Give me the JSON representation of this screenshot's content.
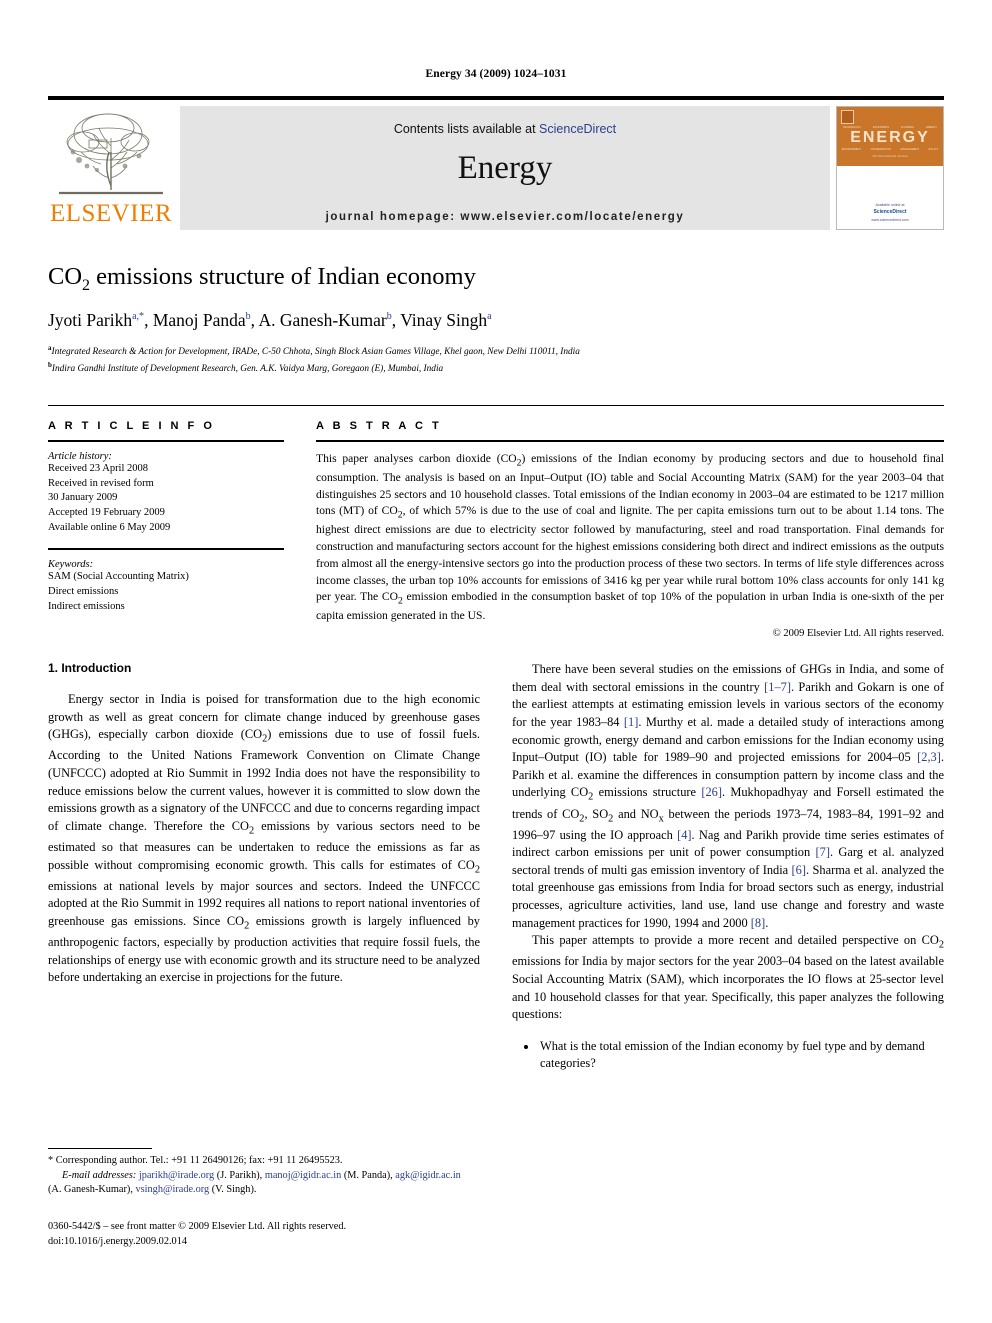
{
  "running_head": "Energy 34 (2009) 1024–1031",
  "masthead": {
    "publisher_logo_label": "ELSEVIER",
    "contents_prefix": "Contents lists available at",
    "contents_link": "ScienceDirect",
    "journal_name": "Energy",
    "homepage": "journal homepage: www.elsevier.com/locate/energy",
    "cover": {
      "title": "ENERGY",
      "subtitle": "The International Journal",
      "top_row_labels": [
        "TECHNOLOGY",
        "ECONOMICS",
        "PLANNING",
        "ENERGY"
      ],
      "bottom_row_labels": [
        "ENVIRONMENT",
        "CONSERVATION",
        "MANAGEMENT",
        "POLICY"
      ],
      "footer_line1": "Available online at",
      "footer_brand": "ScienceDirect",
      "footer_line2": "www.sciencedirect.com"
    }
  },
  "article": {
    "title_html": "CO2 emissions structure of Indian economy",
    "title_main": "CO",
    "title_sub": "2",
    "title_rest": " emissions structure of Indian economy",
    "authors": [
      {
        "name": "Jyoti Parikh",
        "marks": "a,*"
      },
      {
        "name": "Manoj Panda",
        "marks": "b"
      },
      {
        "name": "A. Ganesh-Kumar",
        "marks": "b"
      },
      {
        "name": "Vinay Singh",
        "marks": "a"
      }
    ],
    "affiliations": [
      {
        "mark": "a",
        "text": "Integrated Research & Action for Development, IRADe, C-50 Chhota, Singh Block Asian Games Village, Khel gaon, New Delhi 110011, India"
      },
      {
        "mark": "b",
        "text": "Indira Gandhi Institute of Development Research, Gen. A.K. Vaidya Marg, Goregaon (E), Mumbai, India"
      }
    ]
  },
  "article_info": {
    "heading": "A R T I C L E   I N F O",
    "history_label": "Article history:",
    "history": [
      "Received 23 April 2008",
      "Received in revised form",
      "30 January 2009",
      "Accepted 19 February 2009",
      "Available online 6 May 2009"
    ],
    "keywords_label": "Keywords:",
    "keywords": [
      "SAM (Social Accounting Matrix)",
      "Direct emissions",
      "Indirect emissions"
    ]
  },
  "abstract": {
    "heading": "A B S T R A C T",
    "text": "This paper analyses carbon dioxide (CO2) emissions of the Indian economy by producing sectors and due to household final consumption. The analysis is based on an Input–Output (IO) table and Social Accounting Matrix (SAM) for the year 2003–04 that distinguishes 25 sectors and 10 household classes. Total emissions of the Indian economy in 2003–04 are estimated to be 1217 million tons (MT) of CO2, of which 57% is due to the use of coal and lignite. The per capita emissions turn out to be about 1.14 tons. The highest direct emissions are due to electricity sector followed by manufacturing, steel and road transportation. Final demands for construction and manufacturing sectors account for the highest emissions considering both direct and indirect emissions as the outputs from almost all the energy-intensive sectors go into the production process of these two sectors. In terms of life style differences across income classes, the urban top 10% accounts for emissions of 3416 kg per year while rural bottom 10% class accounts for only 141 kg per year. The CO2 emission embodied in the consumption basket of top 10% of the population in urban India is one-sixth of the per capita emission generated in the US.",
    "copyright": "© 2009 Elsevier Ltd. All rights reserved."
  },
  "introduction": {
    "heading": "1. Introduction",
    "left_paragraphs": [
      "Energy sector in India is poised for transformation due to the high economic growth as well as great concern for climate change induced by greenhouse gases (GHGs), especially carbon dioxide (CO2) emissions due to use of fossil fuels. According to the United Nations Framework Convention on Climate Change (UNFCCC) adopted at Rio Summit in 1992 India does not have the responsibility to reduce emissions below the current values, however it is committed to slow down the emissions growth as a signatory of the UNFCCC and due to concerns regarding impact of climate change. Therefore the CO2 emissions by various sectors need to be estimated so that measures can be undertaken to reduce the emissions as far as possible without compromising economic growth. This calls for estimates of CO2 emissions at national levels by major sources and sectors. Indeed the UNFCCC adopted at the Rio Summit in 1992 requires all nations to report national inventories of greenhouse gas emissions. Since CO2 emissions growth is largely influenced by anthropogenic factors, especially by production activities that require fossil fuels, the relationships of energy use with economic growth and its structure need to be analyzed before undertaking an exercise in projections for the future."
    ],
    "right_paragraph_1": "There have been several studies on the emissions of GHGs in India, and some of them deal with sectoral emissions in the country [1–7]. Parikh and Gokarn is one of the earliest attempts at estimating emission levels in various sectors of the economy for the year 1983–84 [1]. Murthy et al. made a detailed study of interactions among economic growth, energy demand and carbon emissions for the Indian economy using Input–Output (IO) table for 1989–90 and projected emissions for 2004–05 [2,3]. Parikh et al. examine the differences in consumption pattern by income class and the underlying CO2 emissions structure [26]. Mukhopadhyay and Forsell estimated the trends of CO2, SO2 and NOx between the periods 1973–74, 1983–84, 1991–92 and 1996–97 using the IO approach [4]. Nag and Parikh provide time series estimates of indirect carbon emissions per unit of power consumption [7]. Garg et al. analyzed sectoral trends of multi gas emission inventory of India [6]. Sharma et al. analyzed the total greenhouse gas emissions from India for broad sectors such as energy, industrial processes, agriculture activities, land use, land use change and forestry and waste management practices for 1990, 1994 and 2000 [8].",
    "right_paragraph_2": "This paper attempts to provide a more recent and detailed perspective on CO2 emissions for India by major sectors for the year 2003–04 based on the latest available Social Accounting Matrix (SAM), which incorporates the IO flows at 25-sector level and 10 household classes for that year. Specifically, this paper analyzes the following questions:",
    "questions": [
      "What is the total emission of the Indian economy by fuel type and by demand categories?"
    ]
  },
  "footnote": {
    "corresponding": "* Corresponding author. Tel.: +91 11 26490126; fax: +91 11 26495523.",
    "email_label": "E-mail addresses:",
    "emails": [
      {
        "address": "jparikh@irade.org",
        "owner": "(J. Parikh)"
      },
      {
        "address": "manoj@igidr.ac.in",
        "owner": "(M. Panda)"
      },
      {
        "address": "agk@igidr.ac.in",
        "owner": "(A. Ganesh-Kumar)"
      },
      {
        "address": "vsingh@irade.org",
        "owner": "(V. Singh)"
      }
    ],
    "imprint_line1": "0360-5442/$ – see front matter © 2009 Elsevier Ltd. All rights reserved.",
    "imprint_line2": "doi:10.1016/j.energy.2009.02.014"
  },
  "colors": {
    "link": "#2b3d8f",
    "elsevier_orange": "#ef7d00",
    "cover_orange": "#c9762a",
    "banner_gray": "#e4e4e4"
  }
}
